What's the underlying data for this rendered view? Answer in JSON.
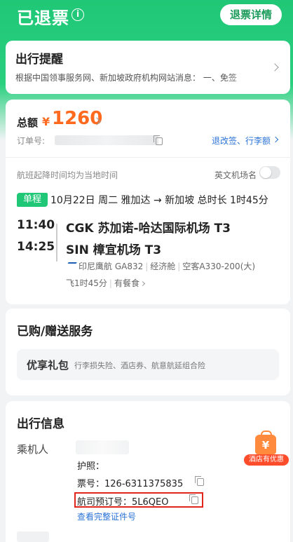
{
  "header": {
    "status_title": "已退票",
    "info_icon": "i",
    "detail_button": "退票详情"
  },
  "reminder": {
    "title": "出行提醒",
    "text": "根据中国领事服务网、新加坡政府机构网站消息：  一、免签"
  },
  "order": {
    "total_label": "总额",
    "currency": "¥",
    "amount": "1260",
    "order_no_label": "订单号:",
    "change_link": "退改签、行李额"
  },
  "flight": {
    "local_time_note": "航班起降时间均为当地时间",
    "english_airport_label": "英文机场名",
    "trip_type": "单程",
    "route_summary": "10月22日 周二 雅加达 → 新加坡 总时长 1时45分",
    "departure": {
      "time": "11:40",
      "airport": "CGK 苏加诺-哈达国际机场 T3"
    },
    "arrival": {
      "time": "14:25",
      "airport": "SIN 樟宜机场 T3"
    },
    "airline": "印尼鹰航 GA832",
    "cabin": "经济舱",
    "aircraft": "空客A330-200(大)",
    "duration": "飞1时45分",
    "meal": "有餐食"
  },
  "services": {
    "title": "已购/赠送服务",
    "gift_title": "优享礼包",
    "gift_desc": "行李损失险、酒店券、航意航延组合险"
  },
  "travel": {
    "title": "出行信息",
    "passenger_label": "乘机人",
    "passport": "护照：",
    "ticket_no": "票号：126-6311375835",
    "pnr": "航司预订号：5L6QEO",
    "view_docs_link": "查看完整证件号"
  },
  "hotel_badge": {
    "icon_text": "¥",
    "label": "酒店有优惠"
  },
  "colors": {
    "brand_green": "#1fc776",
    "price_orange": "#ff6a1f",
    "link_blue": "#2b73d6",
    "highlight_red": "#e0261c"
  }
}
